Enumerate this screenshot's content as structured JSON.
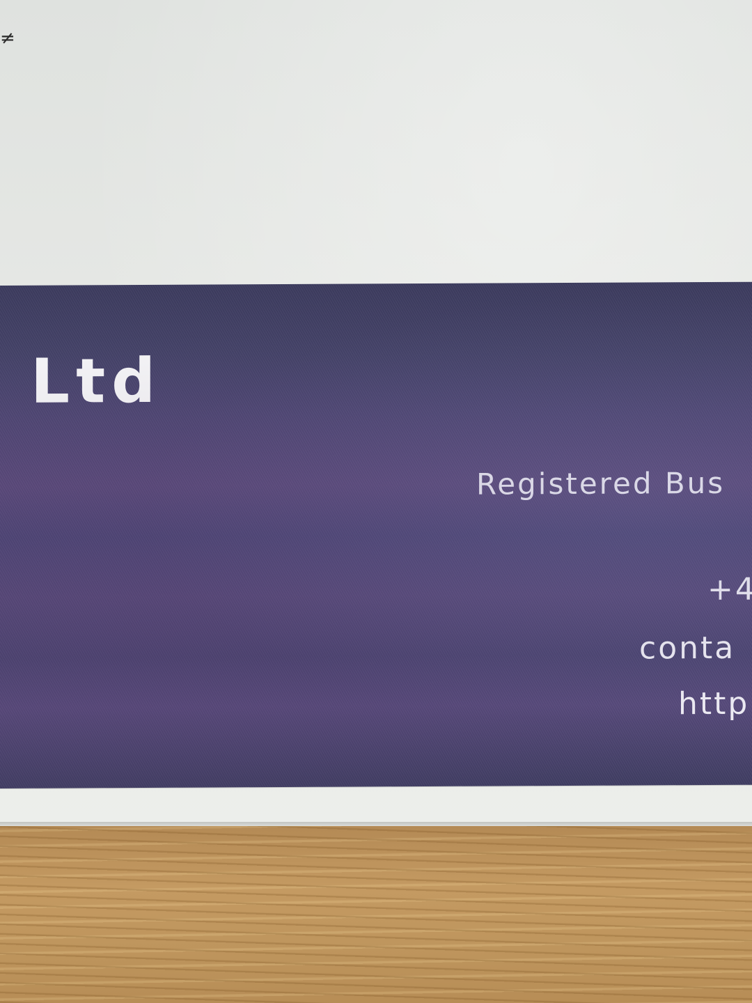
{
  "paper_mark": "≠",
  "banner": {
    "company_fragment": "Ltd",
    "registered_line": "Registered Bus",
    "phone_line": "+4",
    "email_line": "conta",
    "website_line": "http"
  },
  "colors": {
    "paper": "#e3e5e3",
    "banner": "#4c4575",
    "banner_text": "#f4f4f6",
    "wood": "#c49a62"
  }
}
